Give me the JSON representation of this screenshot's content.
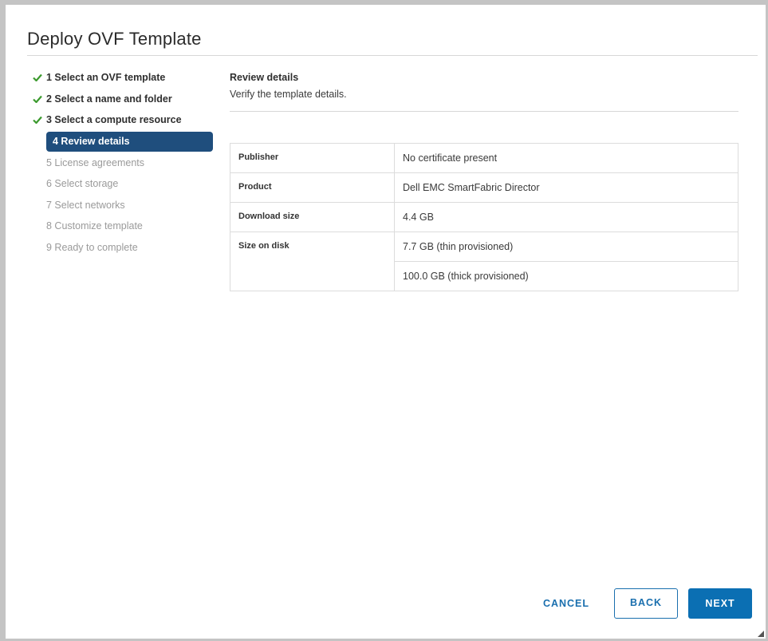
{
  "dialog": {
    "title": "Deploy OVF Template"
  },
  "steps": [
    {
      "label": "1 Select an OVF template",
      "state": "done"
    },
    {
      "label": "2 Select a name and folder",
      "state": "done"
    },
    {
      "label": "3 Select a compute resource",
      "state": "done"
    },
    {
      "label": "4 Review details",
      "state": "active"
    },
    {
      "label": "5 License agreements",
      "state": "pending"
    },
    {
      "label": "6 Select storage",
      "state": "pending"
    },
    {
      "label": "7 Select networks",
      "state": "pending"
    },
    {
      "label": "8 Customize template",
      "state": "pending"
    },
    {
      "label": "9 Ready to complete",
      "state": "pending"
    }
  ],
  "content": {
    "title": "Review details",
    "subtitle": "Verify the template details.",
    "rows": [
      {
        "key": "Publisher",
        "value": "No certificate present"
      },
      {
        "key": "Product",
        "value": "Dell EMC SmartFabric Director"
      },
      {
        "key": "Download size",
        "value": "4.4 GB"
      },
      {
        "key": "Size on disk",
        "value": "7.7 GB (thin provisioned)",
        "value2": "100.0 GB (thick provisioned)"
      }
    ]
  },
  "footer": {
    "cancel_label": "CANCEL",
    "back_label": "BACK",
    "next_label": "NEXT"
  },
  "colors": {
    "accent": "#0b6fb3",
    "active_step_bg": "#1f4e7d",
    "check_green": "#3c9a2e"
  },
  "icons": {
    "completed_step": "check-icon",
    "resize": "resize-grip-icon"
  }
}
